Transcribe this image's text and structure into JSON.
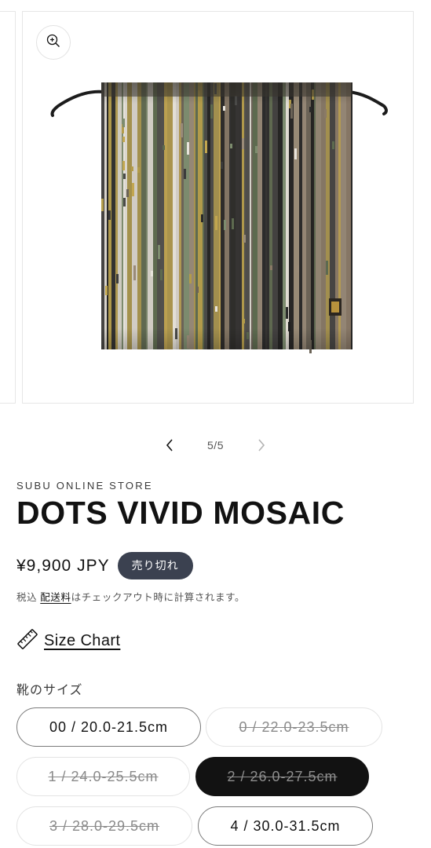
{
  "gallery": {
    "counter": "5/5",
    "zoom_icon": "zoom-in-icon",
    "prev_icon": "chevron-left-icon",
    "next_icon": "chevron-right-icon"
  },
  "product": {
    "vendor": "SUBU ONLINE STORE",
    "title": "DOTS VIVID MOSAIC",
    "price": "¥9,900 JPY",
    "badge": "売り切れ",
    "tax_prefix": "税込 ",
    "shipping_link": "配送料",
    "tax_suffix": "はチェックアウト時に計算されます。"
  },
  "size_chart": {
    "label": "Size Chart",
    "icon": "ruler-icon"
  },
  "variants": {
    "label": "靴のサイズ",
    "options": [
      {
        "label": "00 / 20.0-21.5cm",
        "available": true,
        "selected": false
      },
      {
        "label": "0 / 22.0-23.5cm",
        "available": false,
        "selected": false
      },
      {
        "label": "1 / 24.0-25.5cm",
        "available": false,
        "selected": false
      },
      {
        "label": "2 / 26.0-27.5cm",
        "available": false,
        "selected": true
      },
      {
        "label": "3 / 28.0-29.5cm",
        "available": false,
        "selected": false
      },
      {
        "label": "4 / 30.0-31.5cm",
        "available": true,
        "selected": false
      }
    ]
  },
  "colors": {
    "badge_bg": "#3b4150",
    "text": "#121212",
    "selected_pill": "#121212"
  }
}
